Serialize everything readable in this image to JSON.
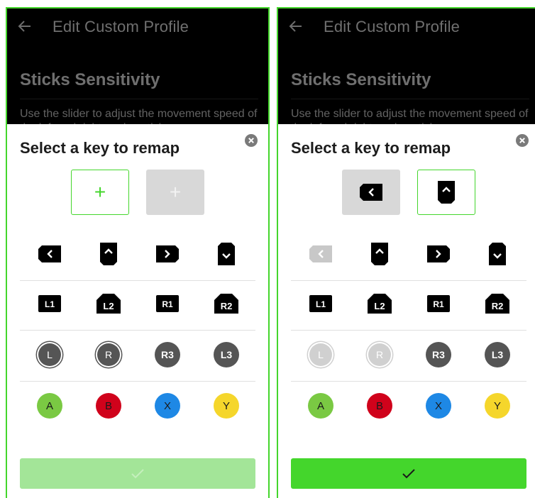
{
  "panels": [
    {
      "header_title": "Edit Custom Profile",
      "section_title": "Sticks Sensitivity",
      "section_desc": "Use the slider to adjust the movement speed of the left and right analog sticks.",
      "sheet_title": "Select a key to remap",
      "slot1": {
        "state": "active",
        "label": "+"
      },
      "slot2": {
        "state": "empty",
        "label": "+"
      },
      "keys": {
        "l1": "L1",
        "l2": "L2",
        "r1": "R1",
        "r2": "R2",
        "l": "L",
        "r": "R",
        "r3": "R3",
        "l3": "L3",
        "a": "A",
        "b": "B",
        "x": "X",
        "y": "Y"
      },
      "confirm_state": "disabled"
    },
    {
      "header_title": "Edit Custom Profile",
      "section_title": "Sticks Sensitivity",
      "section_desc": "Use the slider to adjust the movement speed of the left and right analog sticks.",
      "sheet_title": "Select a key to remap",
      "slot1": {
        "state": "filled",
        "value": "dpad-left-icon"
      },
      "slot2": {
        "state": "active",
        "value": "dpad-up-icon"
      },
      "keys": {
        "l1": "L1",
        "l2": "L2",
        "r1": "R1",
        "r2": "R2",
        "l": "L",
        "r": "R",
        "r3": "R3",
        "l3": "L3",
        "a": "A",
        "b": "B",
        "x": "X",
        "y": "Y"
      },
      "confirm_state": "enabled"
    }
  ],
  "colors": {
    "accent": "#44d62c",
    "accent_disabled": "#a3e598",
    "button_a": "#7ac943",
    "button_b": "#d0021b",
    "button_x": "#1e88e5",
    "button_y": "#f5d62b",
    "key_dark": "#000000",
    "key_disabled": "#c8c8c8",
    "stick": "#555555"
  }
}
